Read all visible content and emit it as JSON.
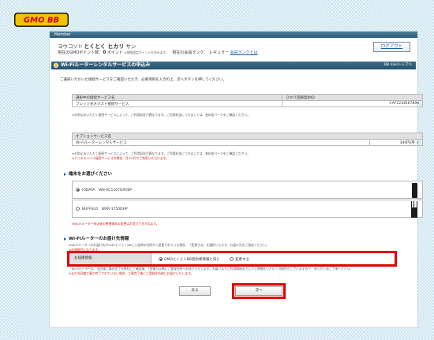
{
  "header": {
    "logo_text": "GMO BB",
    "member_label": "Member",
    "greeting_prefix": "ヨウコソ!!",
    "user_name": "とくとく ヒカリ",
    "greeting_suffix": "サン",
    "points_label": "現在のGMOポイント数：",
    "points_value": "0",
    "points_unit": "ポイント",
    "points_note": "※期限限定ポイントを含みます。",
    "rank_label": "現在の会員ランク",
    "rank_sep": "：",
    "rank_value": "レギュラー",
    "rank_link": "会員ランクとは",
    "logout_label": "ログアウト"
  },
  "section": {
    "title": "Wi-Fiルーターレンタルサービスの申込み",
    "nav_link": "BB naviトップへ"
  },
  "intro_text": "ご選択いただいた接続サービスをご確認いただき、必要項目を入力の上、次へボタンを押してください。",
  "contract_table": {
    "col1": "選択中の接続サービス名",
    "col2": "ひかり回線契約ID",
    "service": "フレッツ光ネクスト接続サービス",
    "id": "CAF1234567890"
  },
  "note1": "※お申込みいただく接続サービスによって、ご利用料金が異なります。ご利用料金につきましては、各料金ページをご確認ください。",
  "option_table": {
    "header": "オプションサービス名",
    "name": "Wi-Fiルーターレンタルサービス",
    "price": "300円/月",
    "remove_icon": "×"
  },
  "note2": "※お申込みいただく接続サービスによって、ご利用料金が異なります。ご利用料金につきましては、各料金ページをご確認ください。",
  "note2_red": "※ドコモモバイル接続サービスの場合、月々0円でご利用いただけます。",
  "device_section": {
    "heading": "端末をお選びください",
    "option1": "IODATA　WN-AC1167GRV6P",
    "option2": "BUFFALO　WXR-1750DHP",
    "warning": "※Wi-Fiルーター申込後の希望端末の変更はお受けできかねます。"
  },
  "delivery_section": {
    "heading": "Wi-Fiルーターのお届け先情報",
    "line1": "※Wi-Fiルーターのお届け先がGMOとくとくBBご入会時の住所から変更されている場合、「変更する」を選択いただき、お届け先をご指定ください。",
    "line2": "※必須項目になります。",
    "address_label": "お届確情報",
    "opt_same": "GMOとくとくBB契約者情報と同じ",
    "opt_change": "変更する",
    "foot1": "・Wi-Fiルーターは、光回線工事の完了を弊社にて確認後、7営業日以降にご登録住所へお送りいたします。お届けまでご利用開始までに少し時間をいただく可能性がございますので、あらかじめご了承ください。",
    "foot2": "※まだ光回線工事が完了されていない場合、工事完了後にご登録住所宛にお届けいたします。"
  },
  "buttons": {
    "back": "戻る",
    "next": "次へ"
  },
  "colors": {
    "highlight": "#e00000",
    "header_bar": "#2e5c77",
    "link": "#1d5fa8"
  }
}
